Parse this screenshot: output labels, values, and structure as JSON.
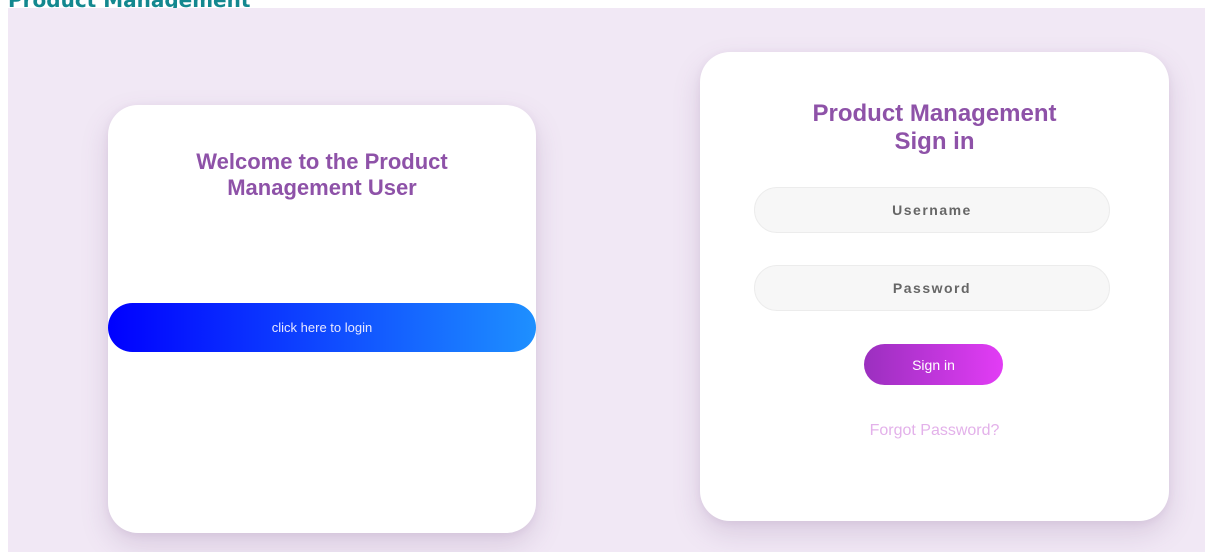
{
  "page": {
    "title": "Product Management"
  },
  "welcome_card": {
    "title": "Welcome to the Product Management User",
    "login_button_label": "click here to login"
  },
  "signin_card": {
    "title_line1": "Product Management",
    "title_line2": "Sign in",
    "username_placeholder": "Username",
    "password_placeholder": "Password",
    "submit_label": "Sign in",
    "forgot_password_label": "Forgot Password?"
  },
  "colors": {
    "page_title": "#13888f",
    "background": "#f1e8f5",
    "heading": "#8e52a8",
    "login_gradient_start": "#0000ff",
    "login_gradient_end": "#1e90ff",
    "signin_gradient_start": "#9b2fbf",
    "signin_gradient_end": "#e23cf5",
    "forgot_link": "#e3b1ea"
  }
}
